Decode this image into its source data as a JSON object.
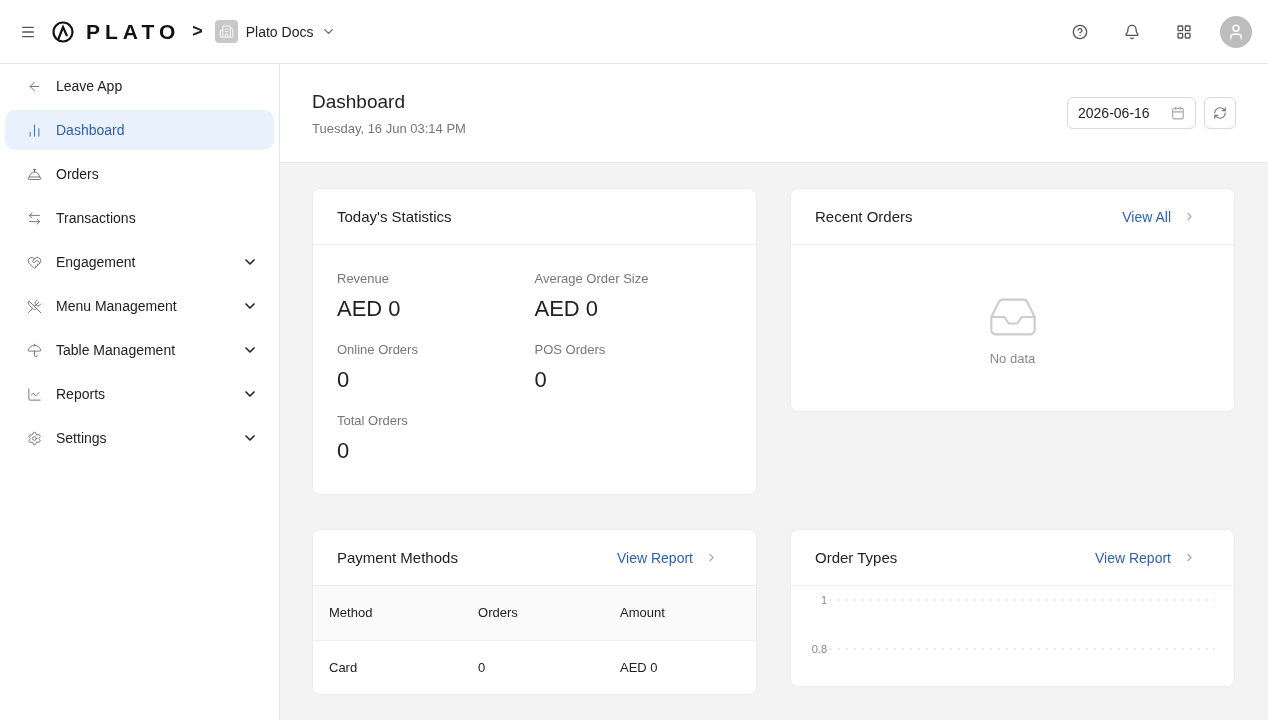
{
  "header": {
    "logo": "PLATO",
    "breadcrumb_separator": ">",
    "workspace": "Plato Docs"
  },
  "sidebar": {
    "items": [
      {
        "label": "Leave App",
        "selected": false,
        "expandable": false
      },
      {
        "label": "Dashboard",
        "selected": true,
        "expandable": false
      },
      {
        "label": "Orders",
        "selected": false,
        "expandable": false
      },
      {
        "label": "Transactions",
        "selected": false,
        "expandable": false
      },
      {
        "label": "Engagement",
        "selected": false,
        "expandable": true
      },
      {
        "label": "Menu Management",
        "selected": false,
        "expandable": true
      },
      {
        "label": "Table Management",
        "selected": false,
        "expandable": true
      },
      {
        "label": "Reports",
        "selected": false,
        "expandable": true
      },
      {
        "label": "Settings",
        "selected": false,
        "expandable": true
      }
    ]
  },
  "page": {
    "title": "Dashboard",
    "subtitle": "Tuesday, 16 Jun 03:14 PM",
    "date": "2026-06-16"
  },
  "statistics": {
    "title": "Today's Statistics",
    "stats": [
      {
        "label": "Revenue",
        "value": "AED 0"
      },
      {
        "label": "Average Order Size",
        "value": "AED 0"
      },
      {
        "label": "Online Orders",
        "value": "0"
      },
      {
        "label": "POS Orders",
        "value": "0"
      },
      {
        "label": "Total Orders",
        "value": "0"
      }
    ]
  },
  "recent_orders": {
    "title": "Recent Orders",
    "link": "View All",
    "empty": "No data"
  },
  "payment_methods": {
    "title": "Payment Methods",
    "link": "View Report",
    "columns": [
      "Method",
      "Orders",
      "Amount"
    ],
    "rows": [
      [
        "Card",
        "0",
        "AED 0"
      ]
    ]
  },
  "order_types": {
    "title": "Order Types",
    "link": "View Report",
    "axis_labels": [
      "1",
      "0.8"
    ]
  }
}
